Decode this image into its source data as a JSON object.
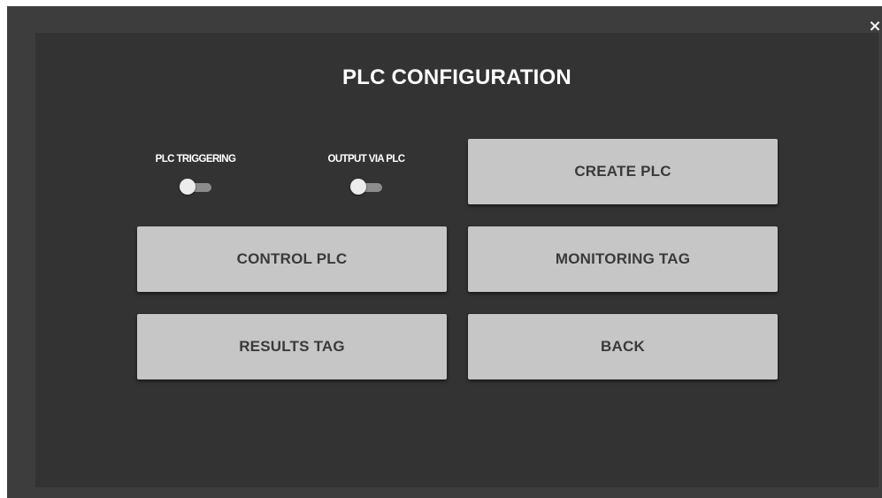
{
  "dialog": {
    "title": "PLC CONFIGURATION",
    "close_label": "×"
  },
  "toggles": [
    {
      "label": "PLC TRIGGERING",
      "state": "off"
    },
    {
      "label": "OUTPUT VIA PLC",
      "state": "off"
    }
  ],
  "buttons": {
    "create_plc": "CREATE PLC",
    "control_plc": "CONTROL PLC",
    "monitoring_tag": "MONITORING TAG",
    "results_tag": "RESULTS TAG",
    "back": "BACK"
  },
  "colors": {
    "overlay": "#3d3d3d",
    "panel": "#333333",
    "button": "#c6c6c6",
    "button_text": "#3a3a3a",
    "toggle_track": "#8c8c8c",
    "toggle_knob": "#ececec"
  }
}
